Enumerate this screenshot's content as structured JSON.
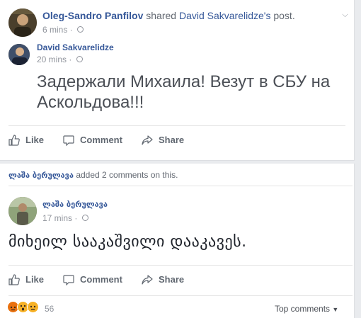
{
  "post1": {
    "sharer_name": "Oleg-Sandro Panfilov",
    "shared_text_prefix": "shared",
    "original_author_possessive": "David Sakvarelidze's",
    "shared_text_suffix": "post.",
    "sharer_time": "6 mins",
    "author_name": "David Sakvarelidze",
    "author_time": "20 mins",
    "text_line1": "Задержали Михаила! Везут в СБУ на",
    "text_line2": "Аскольдова!!!",
    "actions": {
      "like": "Like",
      "comment": "Comment",
      "share": "Share"
    }
  },
  "post2": {
    "activity_name": "ლაშა ბერულავა",
    "activity_text": "added 2 comments on this.",
    "comment_author": "ლაშა ბერულავა",
    "comment_time": "17 mins",
    "comment_text": "მიხეილ სააკაშვილი დააკავეს.",
    "actions": {
      "like": "Like",
      "comment": "Comment",
      "share": "Share"
    },
    "reaction_count": "56",
    "reaction_icons": [
      "angry-icon",
      "wow-icon",
      "sad-icon"
    ],
    "top_comments_label": "Top comments"
  },
  "colors": {
    "link": "#365899",
    "muted": "#90949c",
    "action": "#606770",
    "background": "#e9ebee"
  }
}
